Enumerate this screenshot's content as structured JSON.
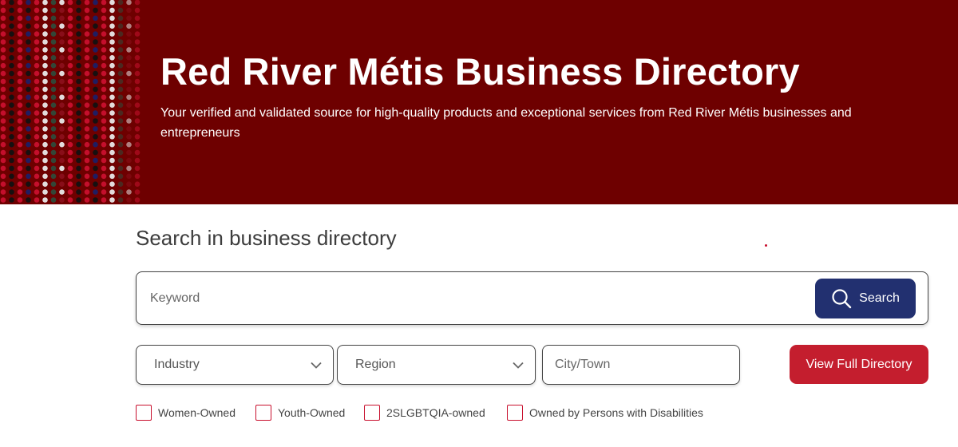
{
  "hero": {
    "title": "Red River Métis Business Directory",
    "subtitle": "Your verified and validated source for high-quality products and exceptional services from Red River Métis businesses and entrepreneurs",
    "background_color": "#6e0000",
    "bead_colors": [
      "#c8102e",
      "#111111",
      "#e8e8e8",
      "#1b1f66",
      "#2f4a3a",
      "#8a0f1a"
    ]
  },
  "search": {
    "title": "Search in business directory",
    "keyword_placeholder": "Keyword",
    "button_label": "Search",
    "button_icon": "search-icon",
    "button_color": "#223070"
  },
  "filters": {
    "industry_label": "Industry",
    "region_label": "Region",
    "city_placeholder": "City/Town",
    "view_full_directory_label": "View Full Directory",
    "view_full_directory_color": "#c41e2e",
    "checkboxes": [
      {
        "label": "Women-Owned",
        "checked": false
      },
      {
        "label": "Youth-Owned",
        "checked": false
      },
      {
        "label": "2SLGBTQIA-owned",
        "checked": false
      },
      {
        "label": "Owned by Persons with Disabilities",
        "checked": false
      }
    ]
  }
}
